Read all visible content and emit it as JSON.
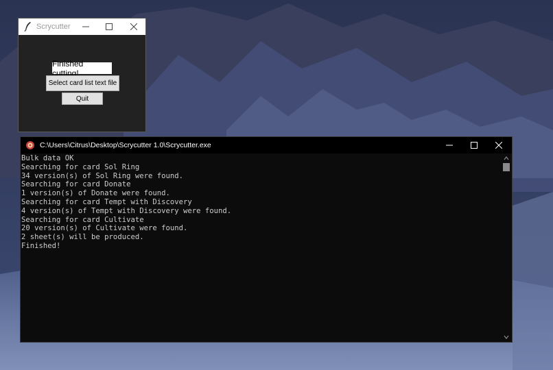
{
  "tk_window": {
    "title": "Scrycutter",
    "status_text": "Finished cutting!",
    "select_button": "Select card list text file",
    "quit_button": "Quit"
  },
  "console_window": {
    "title": "C:\\Users\\Citrus\\Desktop\\Scrycutter 1.0\\Scrycutter.exe",
    "lines": [
      "Bulk data OK",
      "Searching for card Sol Ring",
      "34 version(s) of Sol Ring were found.",
      "Searching for card Donate",
      "1 version(s) of Donate were found.",
      "Searching for card Tempt with Discovery",
      "4 version(s) of Tempt with Discovery were found.",
      "Searching for card Cultivate",
      "20 version(s) of Cultivate were found.",
      "2 sheet(s) will be produced.",
      "Finished!"
    ]
  },
  "icons": {
    "tk_icon": "feather-icon",
    "console_icon": "app-icon",
    "minimize": "minimize-icon",
    "maximize": "maximize-icon",
    "close": "close-icon"
  }
}
